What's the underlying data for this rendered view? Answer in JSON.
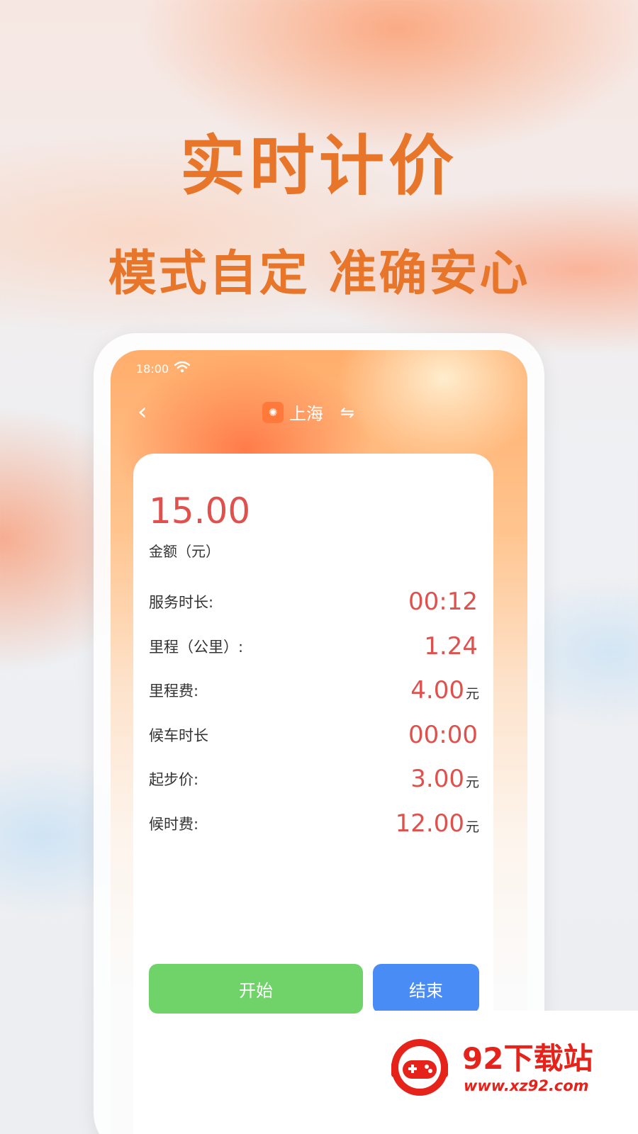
{
  "headline": "实时计价",
  "subline": "模式自定 准确安心",
  "status_bar": {
    "time": "18:00"
  },
  "nav": {
    "city": "上海"
  },
  "meter": {
    "amount": "15.00",
    "amount_label": "金额（元）",
    "rows": [
      {
        "label": "服务时长:",
        "value": "00:12",
        "unit": ""
      },
      {
        "label": "里程（公里）:",
        "value": "1.24",
        "unit": ""
      },
      {
        "label": "里程费:",
        "value": "4.00",
        "unit": "元"
      },
      {
        "label": "候车时长",
        "value": "00:00",
        "unit": ""
      },
      {
        "label": "起步价:",
        "value": "3.00",
        "unit": "元"
      },
      {
        "label": "候时费:",
        "value": "12.00",
        "unit": "元"
      }
    ]
  },
  "buttons": {
    "start": "开始",
    "end": "结束"
  },
  "watermark": {
    "title": "92下载站",
    "url": "www.xz92.com"
  },
  "colors": {
    "accent_orange": "#e8762a",
    "value_red": "#e0504c",
    "start_green": "#6fd36a",
    "end_blue": "#4a8cf5",
    "watermark_red": "#e5231b"
  },
  "icons": [
    "wifi-icon",
    "back-icon",
    "city-icon",
    "swap-icon"
  ]
}
